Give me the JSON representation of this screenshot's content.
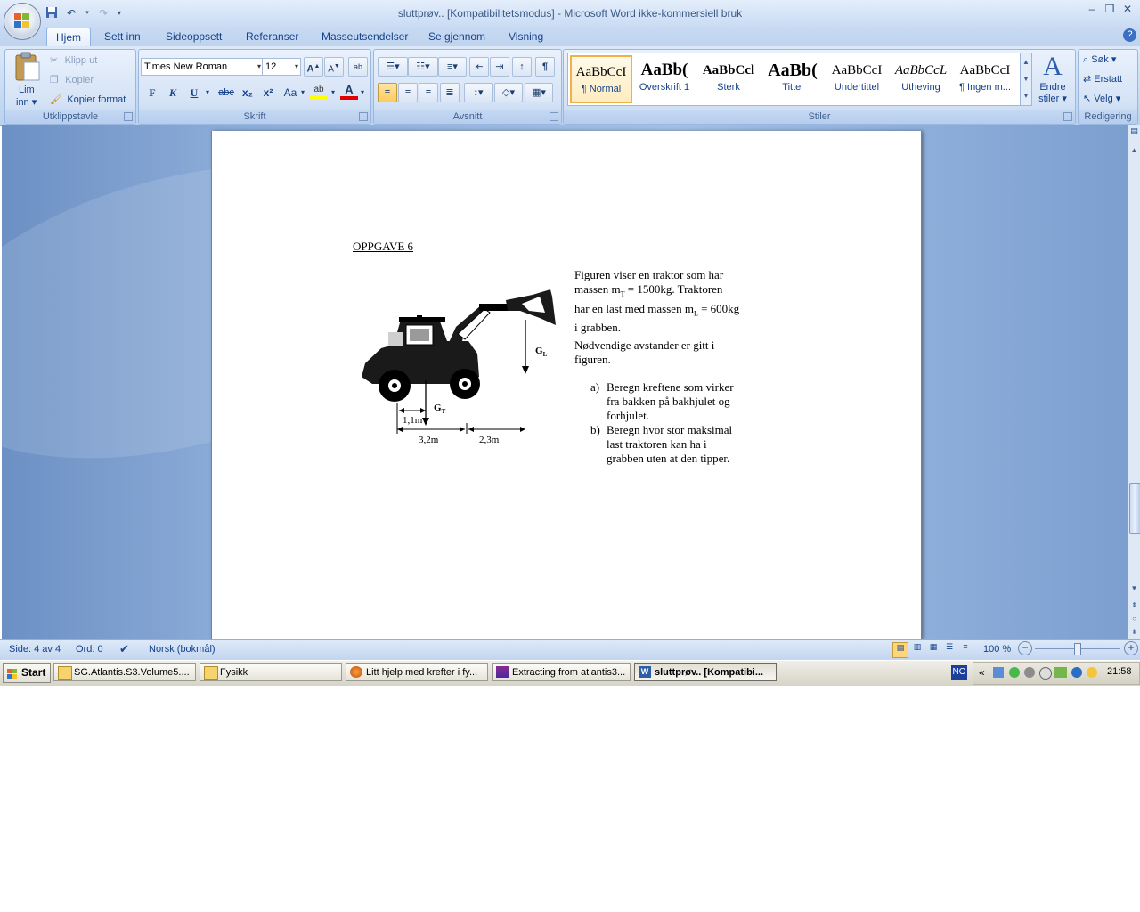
{
  "window": {
    "title": "sluttprøv.. [Kompatibilitetsmodus] - Microsoft Word ikke-kommersiell bruk"
  },
  "tabs": [
    "Hjem",
    "Sett inn",
    "Sideoppsett",
    "Referanser",
    "Masseutsendelser",
    "Se gjennom",
    "Visning"
  ],
  "ribbon": {
    "clipboard": {
      "paste": "Lim",
      "paste2": "inn",
      "cut": "Klipp ut",
      "copy": "Kopier",
      "format_painter": "Kopier format",
      "label": "Utklippstavle"
    },
    "font": {
      "name": "Times New Roman",
      "size": "12",
      "label": "Skrift",
      "bold": "F",
      "italic": "K",
      "underline": "U",
      "strike": "abc",
      "sub": "x₂",
      "sup": "x²",
      "case": "Aa"
    },
    "paragraph": {
      "label": "Avsnitt"
    },
    "styles": {
      "label": "Stiler",
      "items": [
        {
          "preview": "AaBbCcI",
          "name": "¶ Normal"
        },
        {
          "preview": "AaBb(",
          "name": "Overskrift 1"
        },
        {
          "preview": "AaBbCcl",
          "name": "Sterk"
        },
        {
          "preview": "AaBb(",
          "name": "Tittel"
        },
        {
          "preview": "AaBbCcI",
          "name": "Undertittel"
        },
        {
          "preview": "AaBbCcL",
          "name": "Utheving"
        },
        {
          "preview": "AaBbCcI",
          "name": "¶ Ingen m..."
        }
      ],
      "change_styles": "Endre",
      "change_styles2": "stiler"
    },
    "editing": {
      "label": "Redigering",
      "find": "Søk",
      "replace": "Erstatt",
      "select": "Velg"
    }
  },
  "document": {
    "heading": "OPPGAVE 6",
    "para1_lines": [
      "Figuren viser en traktor som har",
      "massen m",
      "T",
      " = 1500kg. Traktoren",
      "har en last med massen m",
      "L",
      " = 600kg",
      "i grabben."
    ],
    "para2_lines": [
      "Nødvendige avstander er gitt i",
      "figuren."
    ],
    "list_a_marker": "a)",
    "list_a": [
      "Beregn kreftene som virker",
      "fra bakken på bakhjulet og",
      "forhjulet."
    ],
    "list_b_marker": "b)",
    "list_b": [
      "Beregn hvor stor maksimal",
      "last traktoren kan ha i",
      "grabben uten at den tipper."
    ],
    "figure": {
      "gl_label": "G",
      "gl_sub": "L",
      "gt_label": "G",
      "gt_sub": "T",
      "d1": "1,1m",
      "d2": "3,2m",
      "d3": "2,3m"
    }
  },
  "status": {
    "page": "Side: 4 av 4",
    "words": "Ord: 0",
    "language": "Norsk (bokmål)",
    "zoom": "100 %"
  },
  "taskbar": {
    "start": "Start",
    "tasks": [
      "SG.Atlantis.S3.Volume5....",
      "Fysikk",
      "Litt hjelp med krefter i fy...",
      "Extracting from atlantis3...",
      "sluttprøv.. [Kompatibi..."
    ],
    "lang": "NO",
    "tray_chevron": "«",
    "clock": "21:58"
  }
}
